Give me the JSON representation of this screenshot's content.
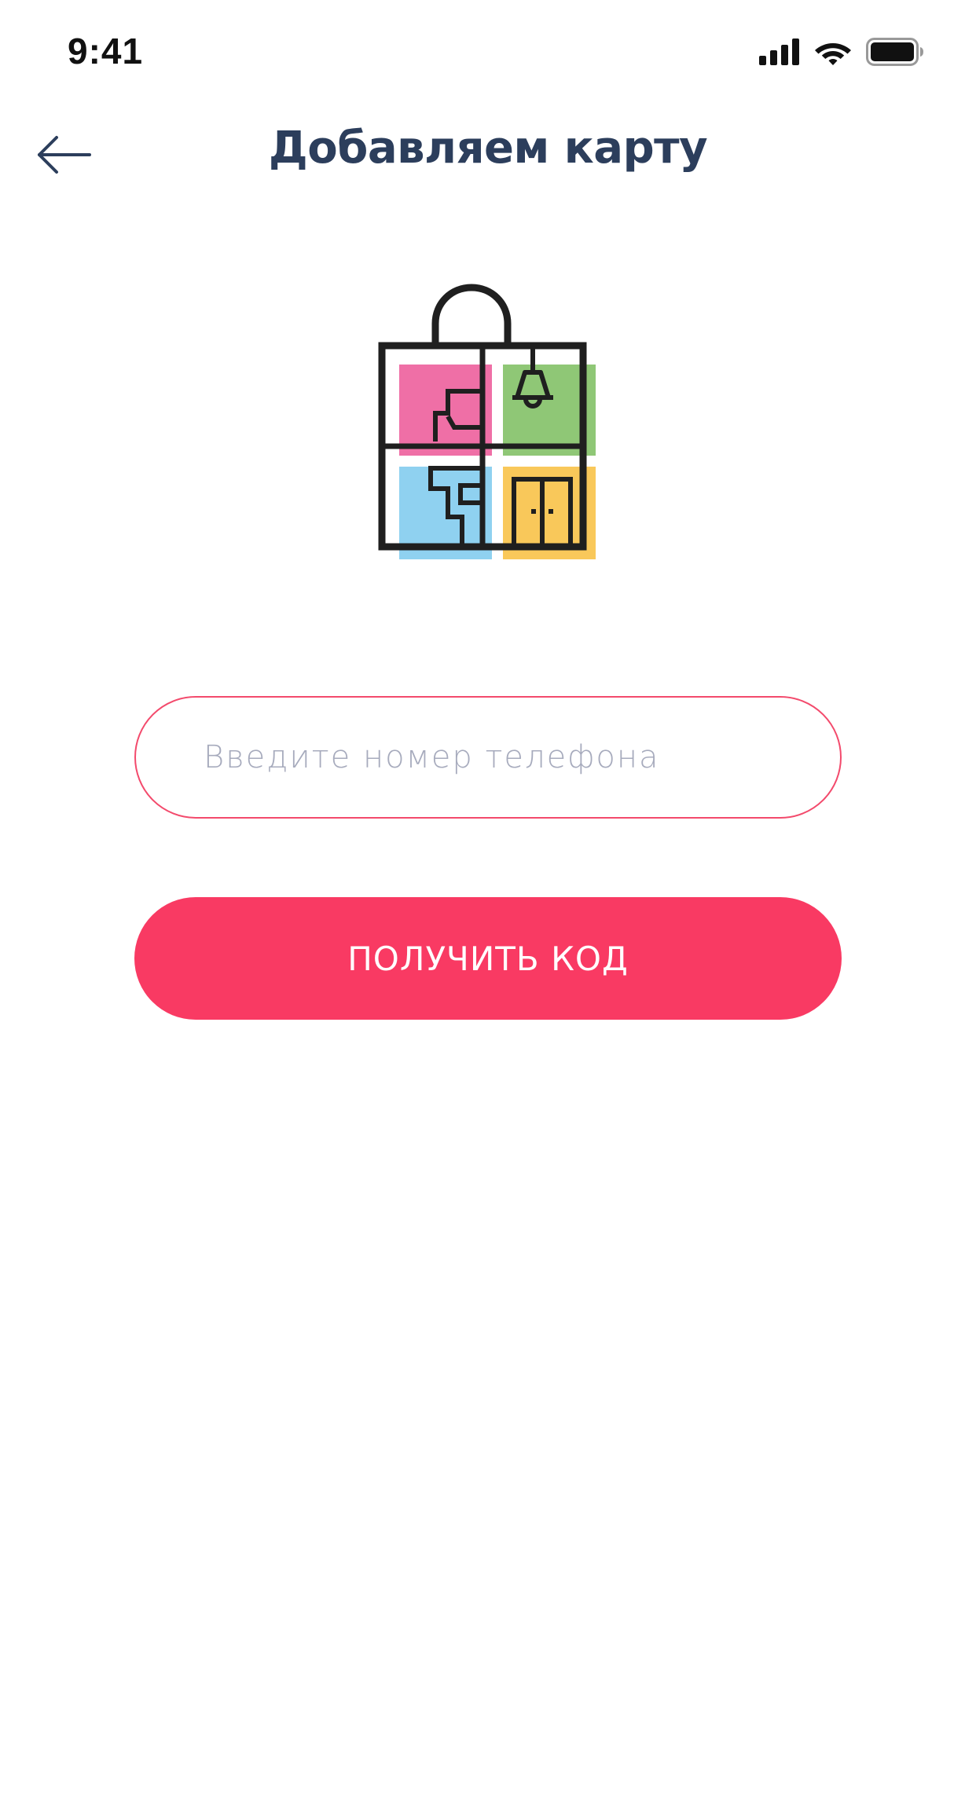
{
  "status_bar": {
    "time": "9:41",
    "icons": [
      "signal-icon",
      "wifi-icon",
      "battery-icon"
    ]
  },
  "header": {
    "back_icon": "arrow-left-icon",
    "title": "Добавляем карту"
  },
  "logo": {
    "icon": "shopping-bag-house-logo",
    "colors": {
      "outline": "#1f1f1f",
      "pink": "#ef6fa6",
      "green": "#8fc776",
      "blue": "#8fd1f0",
      "yellow": "#f9c85a"
    }
  },
  "form": {
    "phone_placeholder": "Введите номер телефона",
    "phone_value": "",
    "submit_label": "ПОЛУЧИТЬ КОД"
  },
  "colors": {
    "accent": "#f93a63",
    "title": "#2c3e5c",
    "placeholder": "#a7abbd"
  }
}
